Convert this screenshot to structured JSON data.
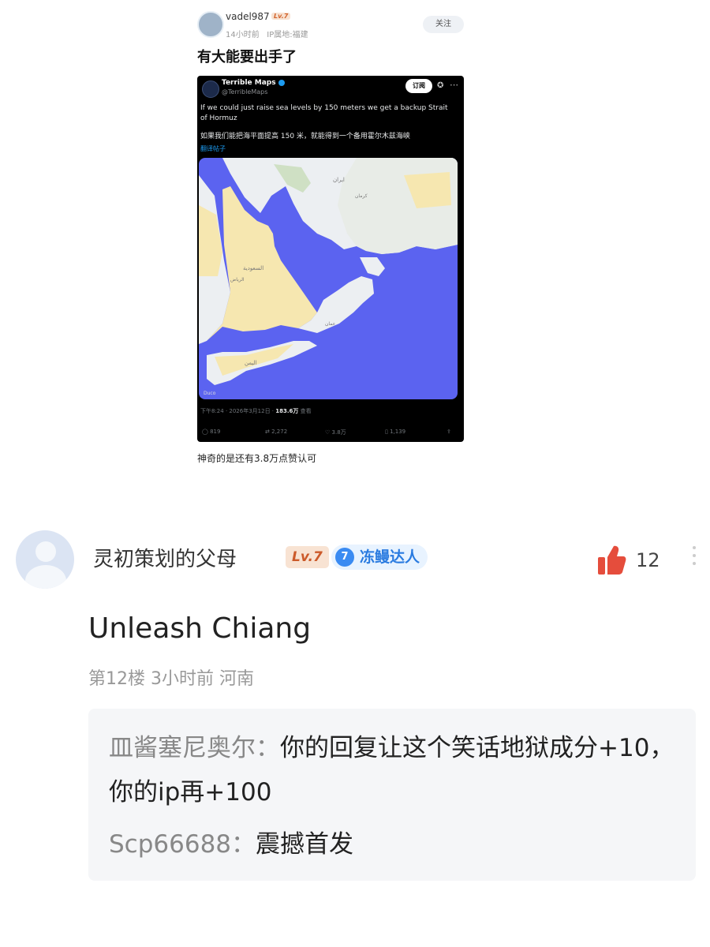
{
  "post": {
    "username": "vadel987",
    "level": "Lv.7",
    "time": "14小时前",
    "ip": "IP属地:福建",
    "follow_label": "关注",
    "title": "有大能要出手了",
    "caption": "神奇的是还有3.8万点赞认可"
  },
  "tweet": {
    "name": "Terrible Maps",
    "handle": "@TerribleMaps",
    "subscribe_label": "订阅",
    "text_en": "If we could just raise sea levels by 150 meters we get a backup Strait of Hormuz",
    "text_zh": "如果我们能把海平面提高 150 米，就能得到一个备用霍尔木兹海峡",
    "translate_label": "翻译帖子",
    "timestamp": "下午8:24 · 2026年3月12日 · ",
    "views": "183.6万",
    "views_suffix": " 查看",
    "stats": {
      "replies": "819",
      "retweets": "2,272",
      "likes": "3.8万",
      "bookmarks": "1,139"
    },
    "map_labels": [
      "السعودية",
      "الرياض",
      "اليمن",
      "عمان",
      "ایران",
      "کرمان"
    ],
    "map_watermark": "Duco"
  },
  "comment": {
    "username": "灵初策划的父母",
    "level": "Lv.7",
    "badge_num": "7",
    "badge_text": "冻鳗达人",
    "like_count": "12",
    "text": "Unleash Chiang",
    "meta": "第12楼  3小时前  河南",
    "replies": [
      {
        "name": "皿酱塞尼奥尔：",
        "text": "你的回复让这个笑话地狱成分+10，你的ip再+100"
      },
      {
        "name": "Scp66688：",
        "text": "震撼首发"
      }
    ]
  },
  "colors": {
    "water": "#5b63f0",
    "land": "#eceff2",
    "desert": "#f6e7b0",
    "like_red": "#e54d3c",
    "badge_blue": "#2a7be0"
  }
}
